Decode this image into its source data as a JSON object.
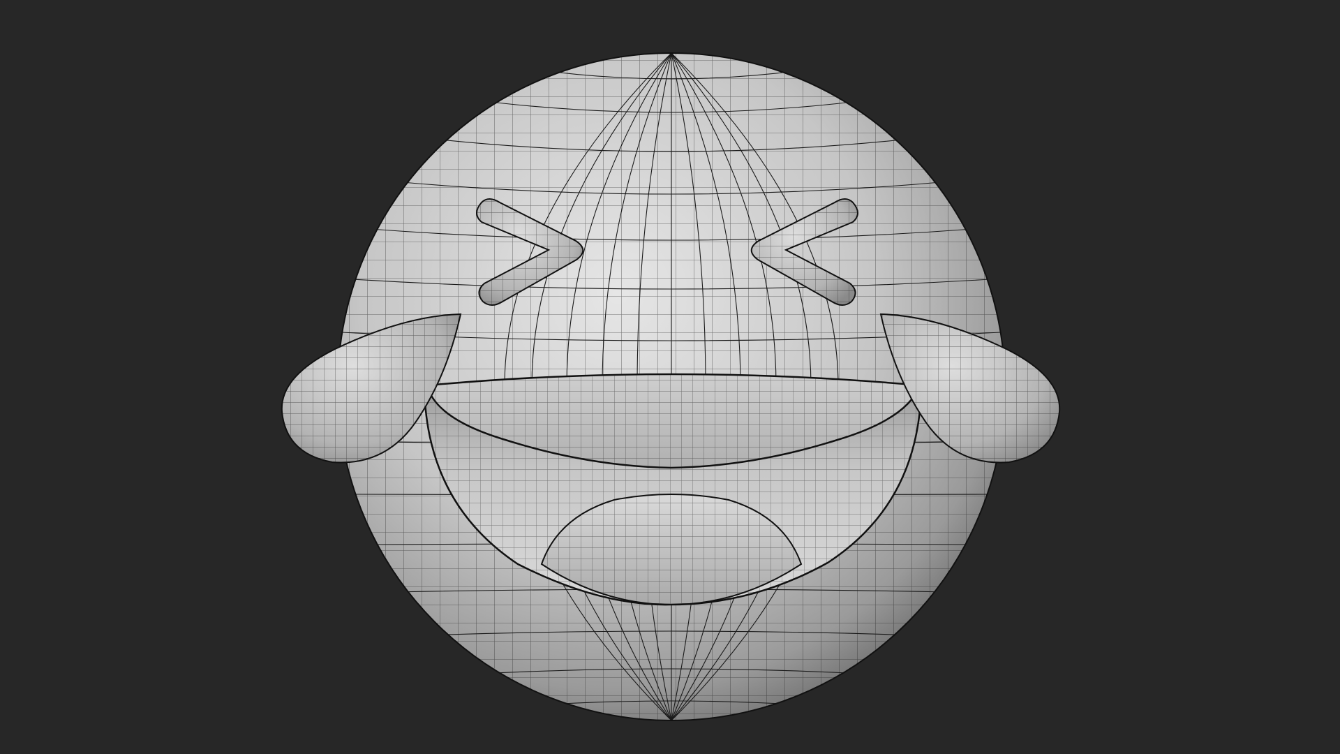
{
  "scene": {
    "background_color": "#272727",
    "model": "face-with-tears-of-joy-emoji",
    "display_mode": "wireframe-over-solid",
    "surface_color": "#d2d2d2",
    "wire_color": "#141414"
  }
}
